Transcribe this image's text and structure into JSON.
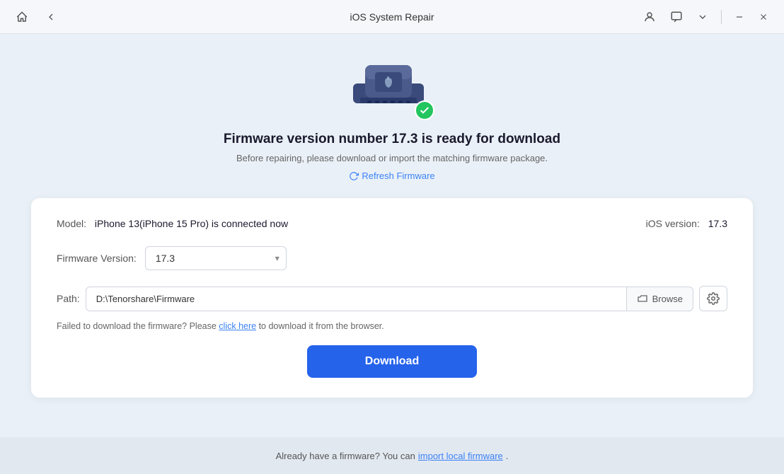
{
  "titlebar": {
    "title": "iOS System Repair",
    "home_icon": "⌂",
    "back_icon": "←",
    "account_icon": "👤",
    "chat_icon": "💬",
    "chevron_icon": "⌄",
    "minimize_icon": "—",
    "close_icon": "✕"
  },
  "hero": {
    "title": "Firmware version number 17.3 is ready for download",
    "subtitle": "Before repairing, please download or import the matching firmware package.",
    "refresh_label": "Refresh Firmware"
  },
  "card": {
    "model_label": "Model:",
    "model_value": "iPhone 13(iPhone 15 Pro) is connected now",
    "ios_label": "iOS version:",
    "ios_value": "17.3",
    "firmware_label": "Firmware Version:",
    "firmware_value": "17.3",
    "path_label": "Path:",
    "path_value": "D:\\Tenorshare\\Firmware",
    "browse_label": "Browse",
    "help_text": "Failed to download the firmware? Please ",
    "help_link_text": "click here",
    "help_text_after": " to download it from the browser.",
    "download_label": "Download"
  },
  "footer": {
    "text": "Already have a firmware? You can ",
    "link_text": "import local firmware",
    "text_after": "."
  }
}
